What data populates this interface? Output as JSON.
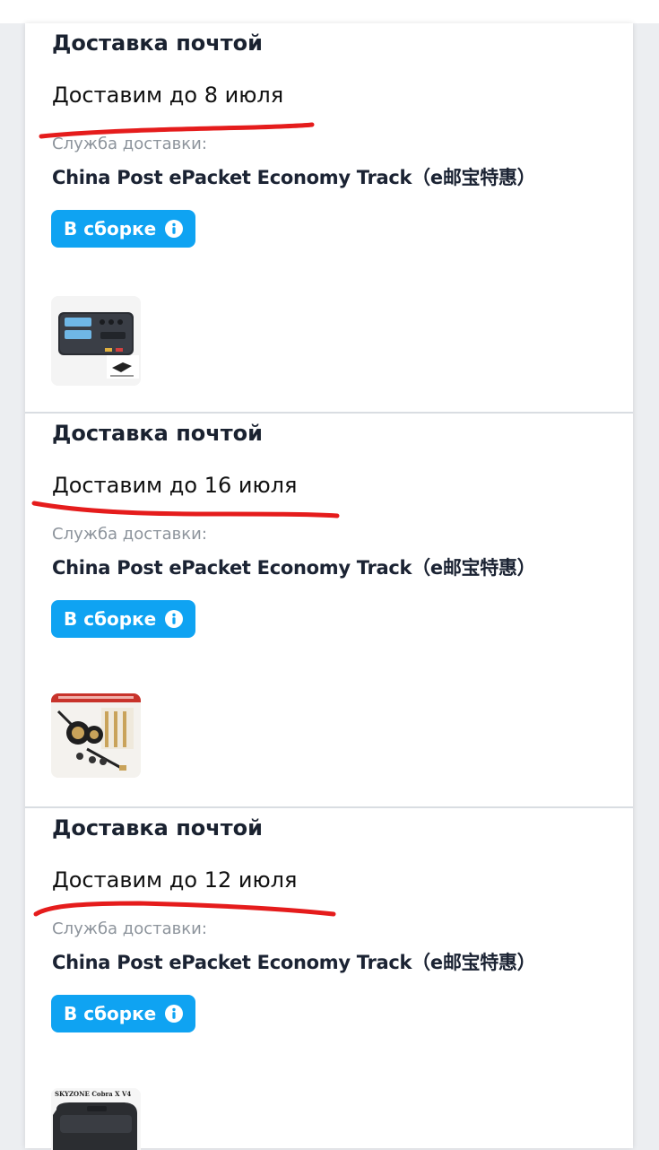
{
  "shipments": [
    {
      "method_title": "Доставка почтой",
      "delivery_date": "Доставим до 8 июля",
      "service_label": "Служба доставки:",
      "service_name": "China Post ePacket Economy Track（e邮宝特惠）",
      "status_badge": "В сборке",
      "product_icon": "battery-charger-image"
    },
    {
      "method_title": "Доставка почтой",
      "delivery_date": "Доставим до 16 июля",
      "service_label": "Служба доставки:",
      "service_name": "China Post ePacket Economy Track（e邮宝特惠）",
      "status_badge": "В сборке",
      "product_icon": "antenna-kit-image"
    },
    {
      "method_title": "Доставка почтой",
      "delivery_date": "Доставим до 12 июля",
      "service_label": "Служба доставки:",
      "service_name": "China Post ePacket Economy Track（e邮宝特惠）",
      "status_badge": "В сборке",
      "product_icon": "fpv-goggles-image",
      "product_image_text": "SKYZONE Cobra X V4"
    }
  ],
  "colors": {
    "badge": "#0fa3f2",
    "annotation": "#e51c1c",
    "title": "#1a2230",
    "muted": "#8d949c"
  }
}
